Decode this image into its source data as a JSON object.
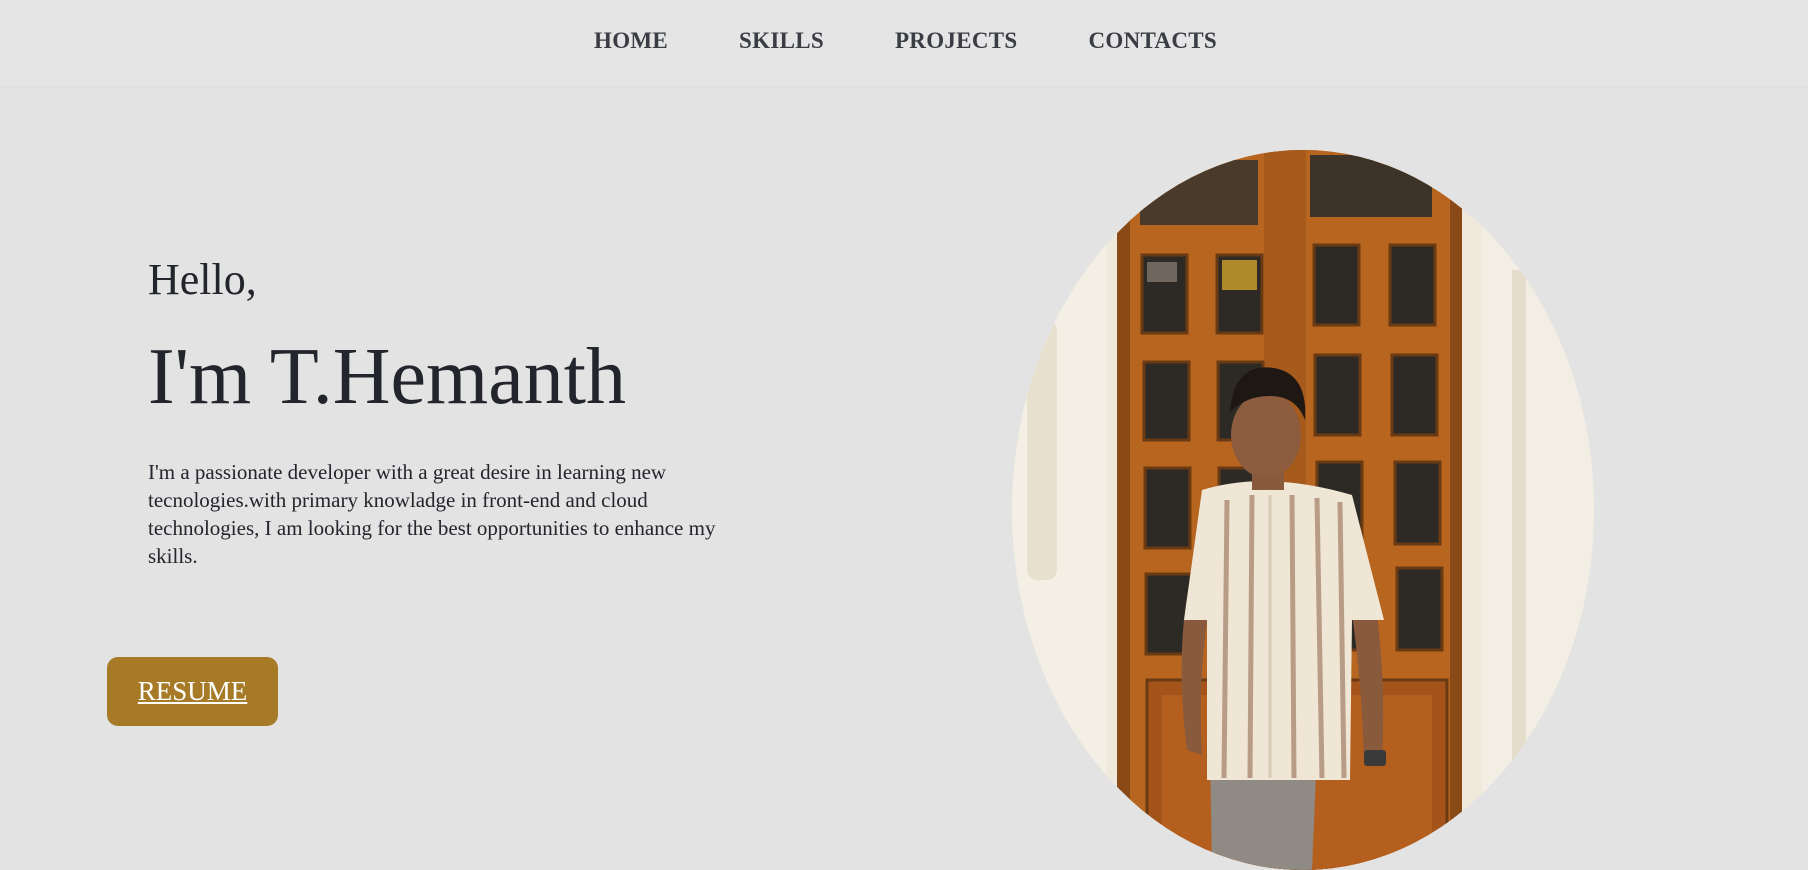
{
  "nav": {
    "items": [
      {
        "label": "HOME"
      },
      {
        "label": "SKILLS"
      },
      {
        "label": "PROJECTS"
      },
      {
        "label": "CONTACTS"
      }
    ]
  },
  "hero": {
    "greeting": "Hello,",
    "name": "I'm T.Hemanth",
    "bio": "I'm a passionate developer with a great desire in learning new tecnologies.with primary knowladge in front-end and cloud technologies, I am looking for the best opportunities to enhance my skills.",
    "resume_label": "RESUME"
  },
  "colors": {
    "background": "#e3e3e3",
    "text": "#22252b",
    "accent": "#a67a27"
  },
  "portrait": {
    "alt": "photo of person in striped shirt standing in front of wooden door"
  }
}
